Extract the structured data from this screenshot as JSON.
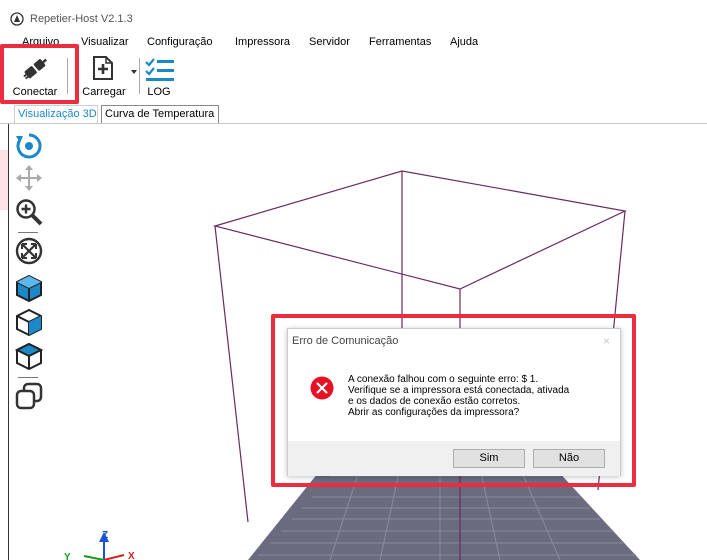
{
  "window": {
    "title": "Repetier-Host V2.1.3"
  },
  "menu": [
    "Arquivo",
    "Visualizar",
    "Configuração",
    "Impressora",
    "Servidor",
    "Ferramentas",
    "Ajuda"
  ],
  "toolbar": {
    "connect_label": "Conectar",
    "load_label": "Carregar",
    "log_label": "LOG"
  },
  "tabs": [
    "Visualização 3D",
    "Curva de Temperatura"
  ],
  "left_tools": [
    "rotate-view-icon",
    "move-view-icon",
    "zoom-icon",
    "fit-view-icon",
    "isometric-view-icon",
    "front-view-icon",
    "top-view-icon",
    "overlap-view-icon"
  ],
  "axes": {
    "x": "X",
    "y": "Y",
    "z": "Z"
  },
  "dialog": {
    "title": "Erro de Comunicação",
    "close": "×",
    "lines": [
      "A conexão falhou com o seguinte erro: $ 1.",
      "Verifique se a impressora está conectada, ativada",
      "e os dados de conexão estão corretos.",
      "Abrir as configurações da impressora?"
    ],
    "yes_label": "Sim",
    "no_label": "Não"
  },
  "colors": {
    "highlight": "#ea2d3f",
    "accent": "#1a88c9",
    "bed": "#6b6b80",
    "box": "#6a2a62"
  }
}
